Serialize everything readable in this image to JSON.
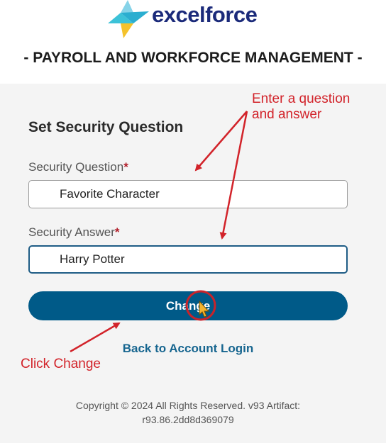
{
  "brand": {
    "name": "excelforce",
    "tagline": "- PAYROLL AND WORKFORCE MANAGEMENT -",
    "colors": {
      "navy": "#1b2a7a",
      "teal": "#3cc2d8",
      "sky": "#86d3e8",
      "yellow": "#f4c22b",
      "primary": "#005a88"
    }
  },
  "form": {
    "title": "Set Security Question",
    "question_label": "Security Question",
    "question_value": "Favorite Character",
    "answer_label": "Security Answer",
    "answer_value": "Harry Potter",
    "required_marker": "*",
    "submit_label": "Change",
    "back_link": "Back to Account Login"
  },
  "footer": {
    "copyright": "Copyright © 2024 All Rights Reserved. v93 Artifact:",
    "build": "r93.86.2dd8d369079"
  },
  "annotations": {
    "enter_note_line1": "Enter a question",
    "enter_note_line2": "and answer",
    "click_note": "Click Change",
    "color": "#d2232a"
  }
}
